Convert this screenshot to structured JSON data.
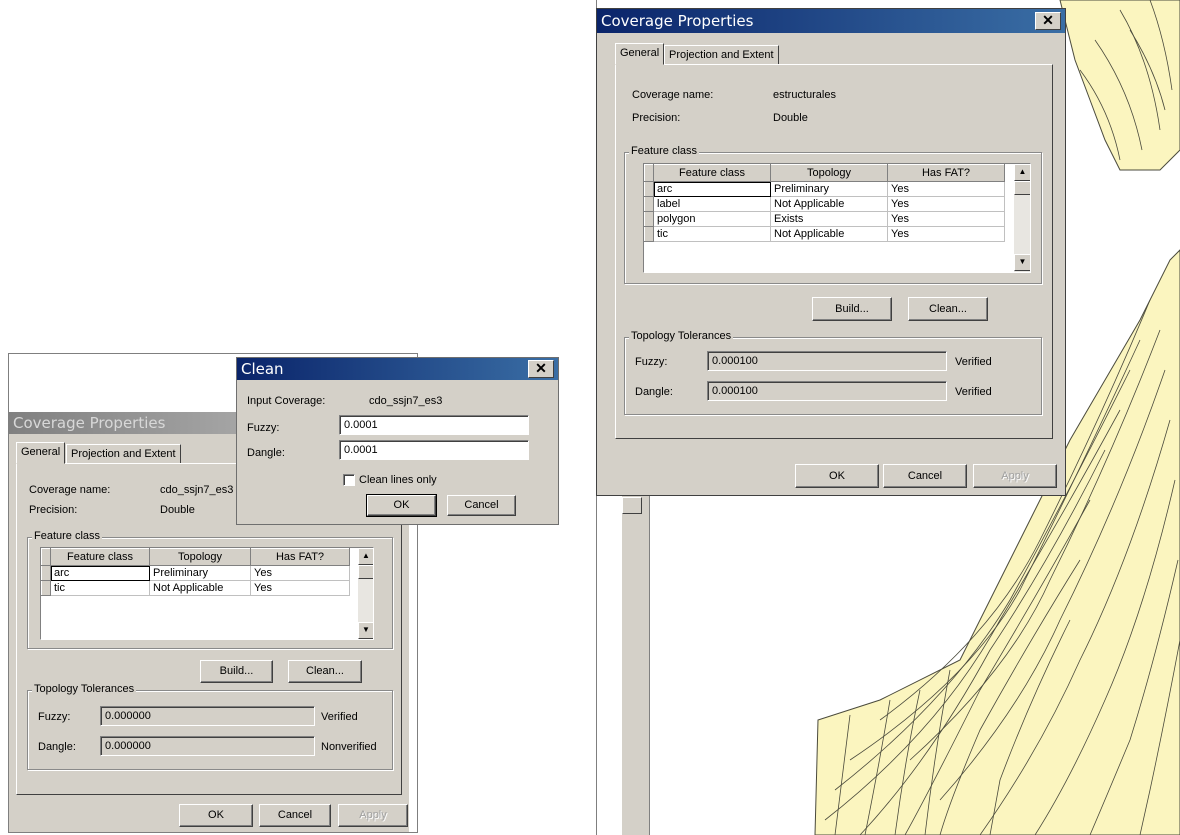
{
  "left": {
    "dialog": {
      "title": "Coverage Properties",
      "tabs": [
        "General",
        "Projection and Extent"
      ],
      "coverage_name_label": "Coverage name:",
      "coverage_name": "cdo_ssjn7_es3",
      "precision_label": "Precision:",
      "precision": "Double",
      "feature_group": "Feature class",
      "columns": [
        "Feature class",
        "Topology",
        "Has FAT?"
      ],
      "rows": [
        [
          "arc",
          "Preliminary",
          "Yes"
        ],
        [
          "tic",
          "Not Applicable",
          "Yes"
        ]
      ],
      "build": "Build...",
      "clean": "Clean...",
      "tol_group": "Topology Tolerances",
      "fuzzy_label": "Fuzzy:",
      "fuzzy": "0.000000",
      "fuzzy_status": "Verified",
      "dangle_label": "Dangle:",
      "dangle": "0.000000",
      "dangle_status": "Nonverified",
      "ok": "OK",
      "cancel": "Cancel",
      "apply": "Apply"
    },
    "clean": {
      "title": "Clean",
      "input_label": "Input Coverage:",
      "input": "cdo_ssjn7_es3",
      "fuzzy_label": "Fuzzy:",
      "fuzzy": "0.0001",
      "dangle_label": "Dangle:",
      "dangle": "0.0001",
      "lines_only": "Clean lines only",
      "ok": "OK",
      "cancel": "Cancel"
    }
  },
  "right": {
    "dialog": {
      "title": "Coverage Properties",
      "tabs": [
        "General",
        "Projection and Extent"
      ],
      "coverage_name_label": "Coverage name:",
      "coverage_name": "estructurales",
      "precision_label": "Precision:",
      "precision": "Double",
      "feature_group": "Feature class",
      "columns": [
        "Feature class",
        "Topology",
        "Has FAT?"
      ],
      "rows": [
        [
          "arc",
          "Preliminary",
          "Yes"
        ],
        [
          "label",
          "Not Applicable",
          "Yes"
        ],
        [
          "polygon",
          "Exists",
          "Yes"
        ],
        [
          "tic",
          "Not Applicable",
          "Yes"
        ]
      ],
      "build": "Build...",
      "clean": "Clean...",
      "tol_group": "Topology Tolerances",
      "fuzzy_label": "Fuzzy:",
      "fuzzy": "0.000100",
      "fuzzy_status": "Verified",
      "dangle_label": "Dangle:",
      "dangle": "0.000100",
      "dangle_status": "Verified",
      "ok": "OK",
      "cancel": "Cancel",
      "apply": "Apply"
    }
  },
  "colors": {
    "map_fill": "#fbf5bf",
    "title_active": "#0a246a",
    "dialog_bg": "#d4d0c8"
  }
}
